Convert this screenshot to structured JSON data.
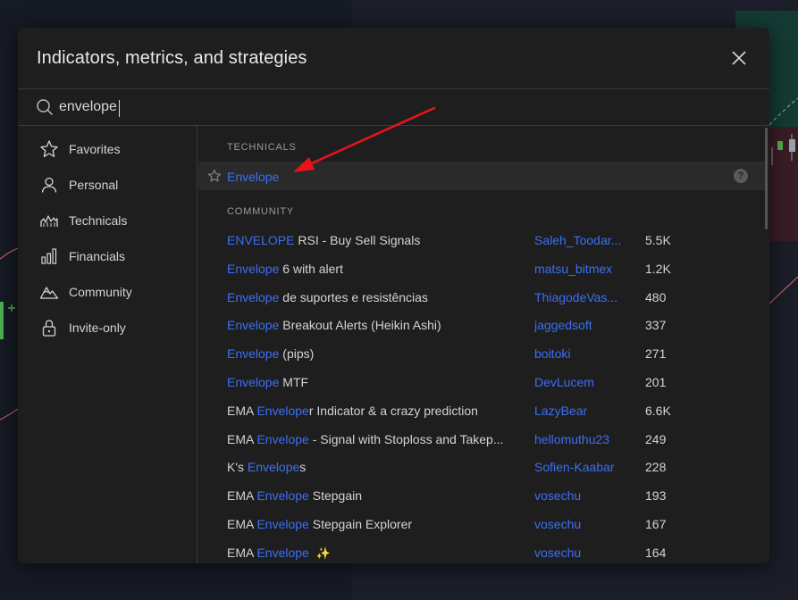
{
  "dialog": {
    "title": "Indicators, metrics, and strategies"
  },
  "search": {
    "value": "envelope",
    "placeholder": "Search"
  },
  "sidebar": {
    "items": [
      {
        "label": "Favorites",
        "icon": "star-icon"
      },
      {
        "label": "Personal",
        "icon": "user-icon"
      },
      {
        "label": "Technicals",
        "icon": "chart-icon"
      },
      {
        "label": "Financials",
        "icon": "bar-chart-icon"
      },
      {
        "label": "Community",
        "icon": "mountain-icon"
      },
      {
        "label": "Invite-only",
        "icon": "lock-icon"
      }
    ]
  },
  "technicals": {
    "section_label": "TECHNICALS",
    "items": [
      {
        "name": "Envelope",
        "help": "?"
      }
    ]
  },
  "community": {
    "section_label": "COMMUNITY",
    "items": [
      {
        "prefix": "",
        "match": "ENVELOPE",
        "suffix": " RSI - Buy Sell Signals",
        "author": "Saleh_Toodar...",
        "count": "5.5K"
      },
      {
        "prefix": "",
        "match": "Envelope",
        "suffix": " 6 with alert",
        "author": "matsu_bitmex",
        "count": "1.2K"
      },
      {
        "prefix": "",
        "match": "Envelope",
        "suffix": " de suportes e resistências",
        "author": "ThiagodeVas...",
        "count": "480"
      },
      {
        "prefix": "",
        "match": "Envelope",
        "suffix": " Breakout Alerts (Heikin Ashi)",
        "author": "jaggedsoft",
        "count": "337"
      },
      {
        "prefix": "",
        "match": "Envelope",
        "suffix": " (pips)",
        "author": "boitoki",
        "count": "271"
      },
      {
        "prefix": "",
        "match": "Envelope",
        "suffix": " MTF",
        "author": "DevLucem",
        "count": "201"
      },
      {
        "prefix": "EMA ",
        "match": "Envelope",
        "suffix": "r Indicator & a crazy prediction",
        "author": "LazyBear",
        "count": "6.6K"
      },
      {
        "prefix": "EMA ",
        "match": "Envelope",
        "suffix": " - Signal with Stoploss and Takep...",
        "author": "hellomuthu23",
        "count": "249"
      },
      {
        "prefix": "K's ",
        "match": "Envelope",
        "suffix": "s",
        "author": "Sofien-Kaabar",
        "count": "228"
      },
      {
        "prefix": "EMA ",
        "match": "Envelope",
        "suffix": " Stepgain",
        "author": "vosechu",
        "count": "193"
      },
      {
        "prefix": "EMA ",
        "match": "Envelope",
        "suffix": " Stepgain Explorer",
        "author": "vosechu",
        "count": "167"
      },
      {
        "prefix": "EMA ",
        "match": "Envelope",
        "suffix": "",
        "author": "vosechu",
        "count": "164",
        "sparkle": "✨"
      }
    ]
  },
  "colors": {
    "accent": "#3b6ff5",
    "annotation_arrow": "#e8141c",
    "dialog_bg": "#1e1e1e"
  }
}
